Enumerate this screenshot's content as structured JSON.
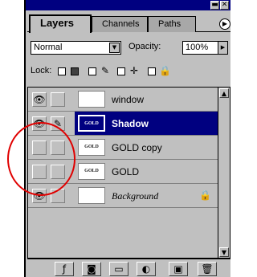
{
  "tabs": [
    {
      "label": "Layers"
    },
    {
      "label": "Channels"
    },
    {
      "label": "Paths"
    }
  ],
  "tab_menu_icon": "▶",
  "window_buttons": {
    "minimize": "▬",
    "close": "✕"
  },
  "blend_mode": {
    "value": "Normal",
    "arrow": "▼"
  },
  "opacity": {
    "label": "Opacity:",
    "value": "100%",
    "arrow": "▶"
  },
  "lock": {
    "label": "Lock:",
    "brush_icon": "✎",
    "move_icon": "✛",
    "lock_icon": "🔒"
  },
  "layers": [
    {
      "name": "window",
      "thumb": "",
      "visible": true,
      "selected": false,
      "italic": false
    },
    {
      "name": "Shadow",
      "thumb": "GOLD",
      "visible": true,
      "selected": true,
      "italic": false,
      "brush": "✎"
    },
    {
      "name": "GOLD copy",
      "thumb": "GOLD",
      "visible": false,
      "selected": false,
      "italic": false
    },
    {
      "name": "GOLD",
      "thumb": "GOLD",
      "visible": false,
      "selected": false,
      "italic": false
    },
    {
      "name": "Background",
      "thumb": "",
      "visible": true,
      "selected": false,
      "italic": true,
      "locked": "🔒"
    }
  ],
  "eye_glyph": "👁",
  "scroll": {
    "up": "▲",
    "down": "▼"
  },
  "bottom_buttons": [
    "ƒ",
    "◙",
    "▭",
    "◐",
    "▣",
    "🗑"
  ],
  "annotation_color": "#e00000"
}
